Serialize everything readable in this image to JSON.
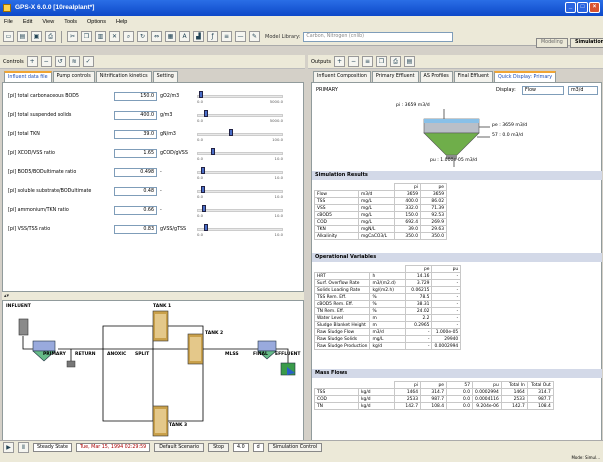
{
  "window": {
    "title": "GPS-X 6.0.0 [10realplant*]"
  },
  "menu": [
    "File",
    "Edit",
    "View",
    "Tools",
    "Options",
    "Help"
  ],
  "toolbar": {
    "model_library_label": "Model Library:",
    "model_library_value": "Carbon, Nitrogen (cnlib)",
    "modeling_button": "Modeling",
    "simulation_button": "Simulation"
  },
  "controls": {
    "label": "Controls",
    "tabs": [
      "Influent data file",
      "Pump controls",
      "Nitrification kinetics",
      "Setting"
    ],
    "active_tab": 0
  },
  "params": [
    {
      "label": "[pi] total carbonaceous BOD5",
      "value": "150.0",
      "unit": "gO2/m3",
      "min": "0.0",
      "max": "5000.0",
      "level": 0.03
    },
    {
      "label": "[pi] total suspended solids",
      "value": "400.0",
      "unit": "g/m3",
      "min": "0.0",
      "max": "5000.0",
      "level": 0.08
    },
    {
      "label": "[pi] total TKN",
      "value": "39.0",
      "unit": "gN/m3",
      "min": "0.0",
      "max": "100.0",
      "level": 0.39
    },
    {
      "label": "[pi] XCOD/VSS ratio",
      "value": "1.65",
      "unit": "gCOD/gVSS",
      "min": "0.0",
      "max": "10.0",
      "level": 0.165
    },
    {
      "label": "[pi] BOD5/BODultimate ratio",
      "value": "0.498",
      "unit": "-",
      "min": "0.0",
      "max": "10.0",
      "level": 0.05
    },
    {
      "label": "[pi] soluble substrate/BODultimate",
      "value": "0.48",
      "unit": "-",
      "min": "0.0",
      "max": "10.0",
      "level": 0.048
    },
    {
      "label": "[pi] ammonium/TKN ratio",
      "value": "0.66",
      "unit": "-",
      "min": "0.0",
      "max": "10.0",
      "level": 0.066
    },
    {
      "label": "[pi] VSS/TSS ratio",
      "value": "0.83",
      "unit": "gVSS/gTSS",
      "min": "0.0",
      "max": "10.0",
      "level": 0.083
    }
  ],
  "flowsheet": {
    "influent": "INFLUENT",
    "tank1": "TANK 1",
    "tank2": "TANK 2",
    "tank3": "TANK 3",
    "primary": "PRIMARY",
    "return": "RETURN",
    "anoxic": "ANOXIC",
    "split": "SPLIT",
    "mlss": "MLSS",
    "final": "FINAL",
    "effluent": "EFFLUENT"
  },
  "outputs": {
    "label": "Outputs",
    "tabs": [
      "Influent Composition",
      "Primary Effluent",
      "AS Profiles",
      "Final Effluent",
      "Quick Display: Primary"
    ],
    "active_tab": 4,
    "display_label": "Display:",
    "display_value": "Flow",
    "unit_value": "m3/d"
  },
  "primary": {
    "title": "PRIMARY",
    "pi": "pi : 3659 m3/d",
    "pe": "pe : 3659 m3/d",
    "s7": "57 : 0.0 m3/d",
    "pu": "pu : 1.000e-05 m3/d"
  },
  "sim": {
    "title": "Simulation Results",
    "cols": [
      "pi",
      "pe"
    ],
    "rows": [
      [
        "Flow",
        "m3/d",
        "3659",
        "3659"
      ],
      [
        "TSS",
        "mg/L",
        "400.0",
        "86.02"
      ],
      [
        "VSS",
        "mg/L",
        "332.0",
        "71.39"
      ],
      [
        "cBOD5",
        "mg/L",
        "150.0",
        "92.53"
      ],
      [
        "COD",
        "mg/L",
        "692.4",
        "269.9"
      ],
      [
        "TKN",
        "mgN/L",
        "39.0",
        "29.63"
      ],
      [
        "Alkalinity",
        "mgCaCO3/L",
        "350.0",
        "350.0"
      ]
    ]
  },
  "ops": {
    "title": "Operational Variables",
    "cols": [
      "pe",
      "pu"
    ],
    "rows": [
      [
        "HRT",
        "h",
        "14.16",
        "-"
      ],
      [
        "Surf. Overflow Rate",
        "m3/(m2.d)",
        "3.729",
        "-"
      ],
      [
        "Solids Loading Rate",
        "kg/(m2.h)",
        "0.06215",
        "-"
      ],
      [
        "TSS Rem. Eff.",
        "%",
        "78.5",
        "-"
      ],
      [
        "cBOD5 Rem. Eff.",
        "%",
        "38.31",
        "-"
      ],
      [
        "TN Rem. Eff.",
        "%",
        "24.02",
        "-"
      ],
      [
        "Water Level",
        "m",
        "2.2",
        "-"
      ],
      [
        "Sludge Blanket Height",
        "m",
        "0.2965",
        "-"
      ],
      [
        "Raw Sludge Flow",
        "m3/d",
        "-",
        "1.000e-05"
      ],
      [
        "Raw Sludge Solids",
        "mg/L",
        "-",
        "29940"
      ],
      [
        "Raw Sludge Production",
        "kg/d",
        "-",
        "0.0002994"
      ]
    ]
  },
  "mass": {
    "title": "Mass Flows",
    "cols": [
      "pi",
      "pe",
      "57",
      "pu",
      "Total In",
      "Total Out"
    ],
    "rows": [
      [
        "TSS",
        "kg/d",
        "1464",
        "314.7",
        "0.0",
        "0.0002994",
        "1464",
        "314.7"
      ],
      [
        "COD",
        "kg/d",
        "2533",
        "987.7",
        "0.0",
        "0.0004116",
        "2533",
        "987.7"
      ],
      [
        "TN",
        "kg/d",
        "142.7",
        "108.4",
        "0.0",
        "9.204e-06",
        "142.7",
        "108.4"
      ]
    ]
  },
  "status": {
    "mode": "Steady State",
    "date": "Tue, Mar 15, 1994 02:29:59",
    "scenario": "Default Scenario",
    "stop": "Stop",
    "speed": "4.0",
    "unit": "d",
    "sim_control": "Simulation Control",
    "footer": "Mode: Simul..."
  }
}
